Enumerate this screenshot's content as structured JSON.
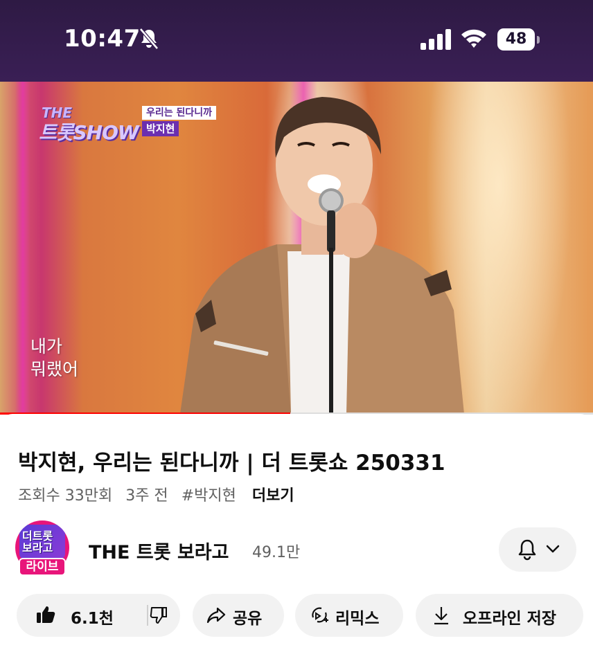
{
  "status_bar": {
    "time": "10:47",
    "battery": "48",
    "icons": [
      "bell-slash-icon",
      "cellular-signal-icon",
      "wifi-icon",
      "battery-icon"
    ]
  },
  "video": {
    "show_logo_top": "THE",
    "show_logo_main": "트롯SHOW",
    "song_tag": "우리는 된다니까",
    "artist_tag": "박지현",
    "lyric_line_1": "내가",
    "lyric_line_2": "뭐랬어",
    "progress": 0.49
  },
  "info": {
    "title": "박지현, 우리는 된다니까 | 더 트롯쇼 250331",
    "views": "조회수 33만회",
    "age": "3주 전",
    "hashtag": "#박지현",
    "more": "더보기"
  },
  "channel": {
    "avatar_text_1": "더트롯",
    "avatar_text_2": "보라고",
    "live_badge": "라이브",
    "name": "THE 트롯 보라고",
    "subscribers": "49.1만"
  },
  "actions": {
    "like_count": "6.1천",
    "share": "공유",
    "remix": "리믹스",
    "download": "오프라인 저장"
  }
}
